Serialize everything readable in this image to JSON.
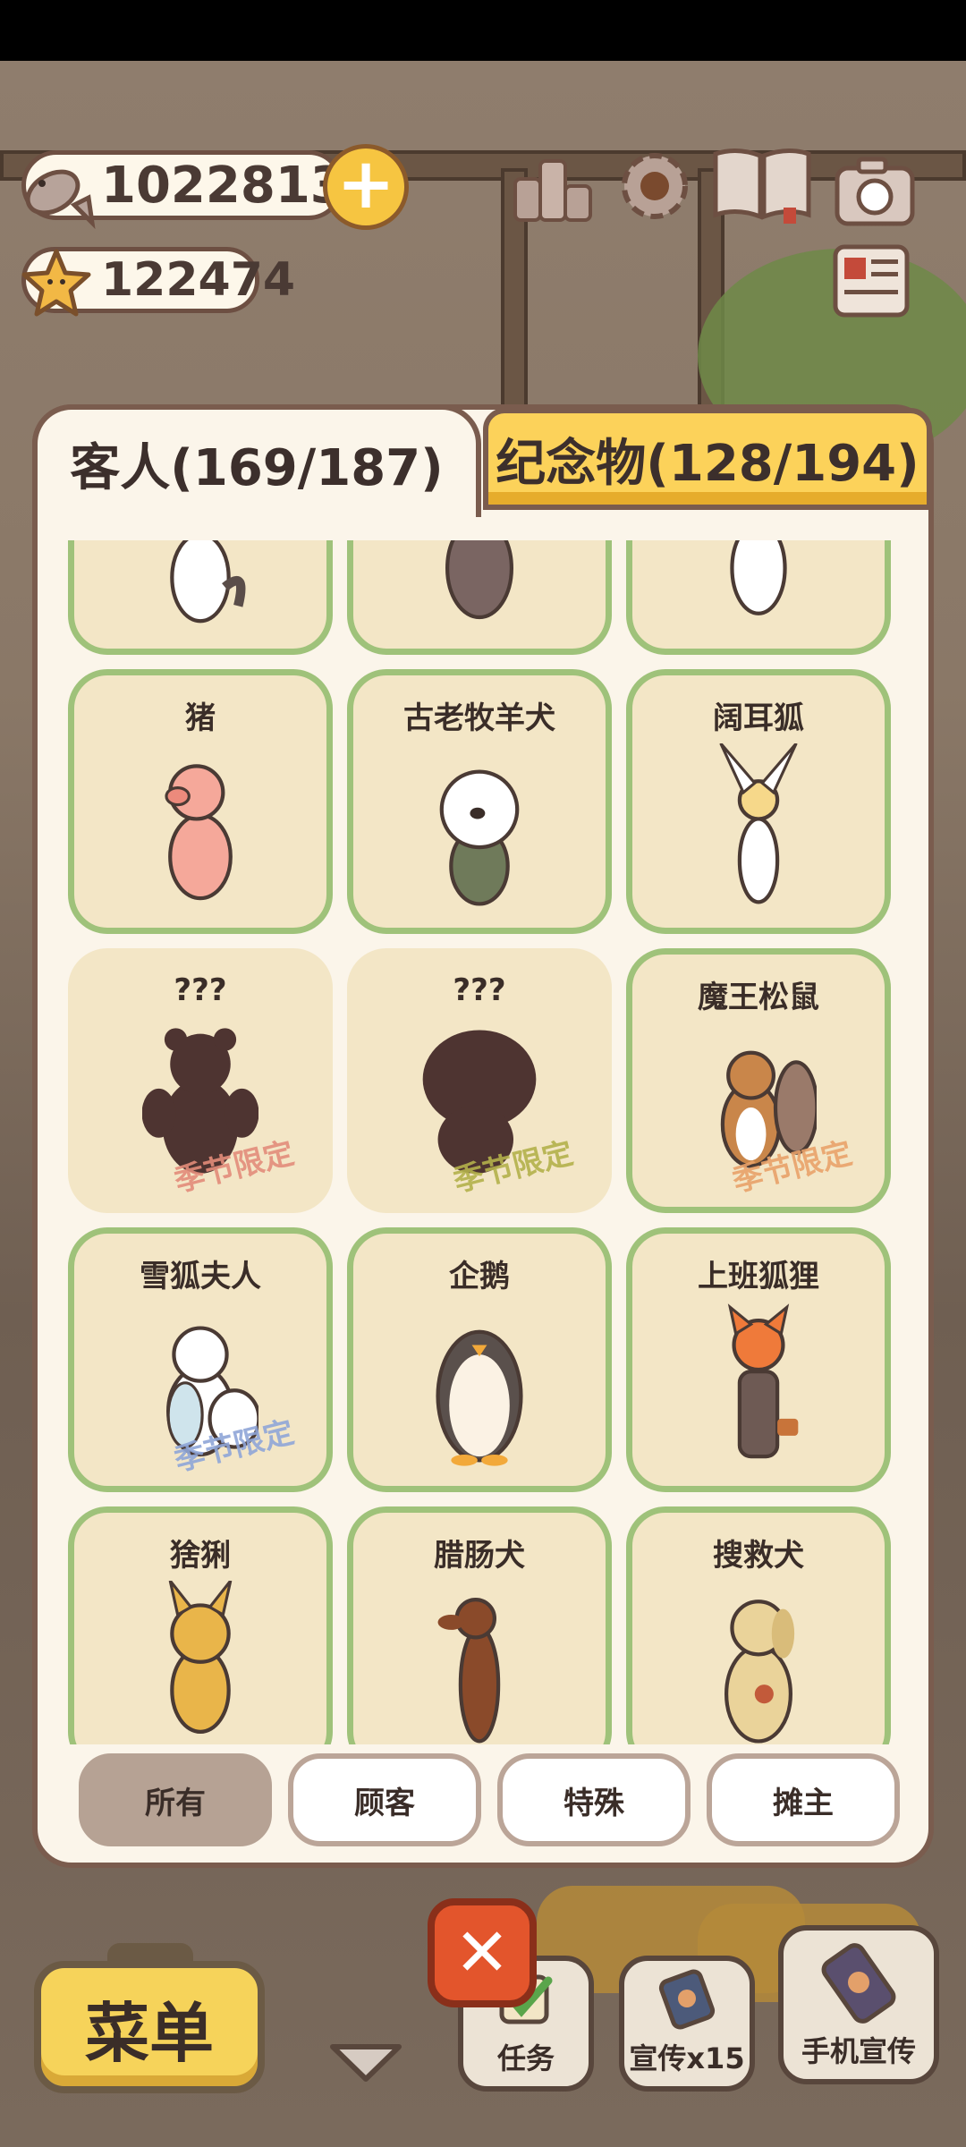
{
  "currencies": {
    "fish": {
      "value": "10228135",
      "icon": "fish-icon"
    },
    "star": {
      "value": "122474",
      "icon": "star-icon"
    }
  },
  "top_icons": [
    "ranking-icon",
    "settings-gear-icon",
    "album-book-icon",
    "camera-icon",
    "newspaper-icon"
  ],
  "tabs": {
    "guests": "客人(169/187)",
    "souvenirs": "纪念物(128/194)"
  },
  "cards": [
    {
      "name": "",
      "animal": "husky",
      "locked": false,
      "season": ""
    },
    {
      "name": "",
      "animal": "crow",
      "locked": false,
      "season": ""
    },
    {
      "name": "",
      "animal": "corgi",
      "locked": false,
      "season": ""
    },
    {
      "name": "猪",
      "animal": "pig",
      "locked": false,
      "season": ""
    },
    {
      "name": "古老牧羊犬",
      "animal": "sheepdog",
      "locked": false,
      "season": ""
    },
    {
      "name": "阔耳狐",
      "animal": "fennec",
      "locked": false,
      "season": ""
    },
    {
      "name": "???",
      "animal": "bear-silhouette",
      "locked": true,
      "season": "季节限定"
    },
    {
      "name": "???",
      "animal": "blob-silhouette",
      "locked": true,
      "season": "季节限定"
    },
    {
      "name": "魔王松鼠",
      "animal": "squirrel",
      "locked": false,
      "season": "季节限定"
    },
    {
      "name": "雪狐夫人",
      "animal": "snow-fox",
      "locked": false,
      "season": "季节限定"
    },
    {
      "name": "企鹅",
      "animal": "penguin",
      "locked": false,
      "season": ""
    },
    {
      "name": "上班狐狸",
      "animal": "office-fox",
      "locked": false,
      "season": ""
    },
    {
      "name": "猞猁",
      "animal": "lynx",
      "locked": false,
      "season": ""
    },
    {
      "name": "腊肠犬",
      "animal": "dachshund",
      "locked": false,
      "season": ""
    },
    {
      "name": "搜救犬",
      "animal": "rescue-dog",
      "locked": false,
      "season": ""
    }
  ],
  "filters": {
    "all": "所有",
    "customers": "顾客",
    "special": "特殊",
    "vendors": "摊主"
  },
  "bottom": {
    "menu": "菜单",
    "tasks": "任务",
    "promo": "宣传x15",
    "phone_promo": "手机宣传"
  },
  "colors": {
    "card_border": "#9fc27a",
    "card_bg": "#f3e6c6",
    "tab_inactive": "#fcd25a",
    "close_button": "#e3552c"
  }
}
